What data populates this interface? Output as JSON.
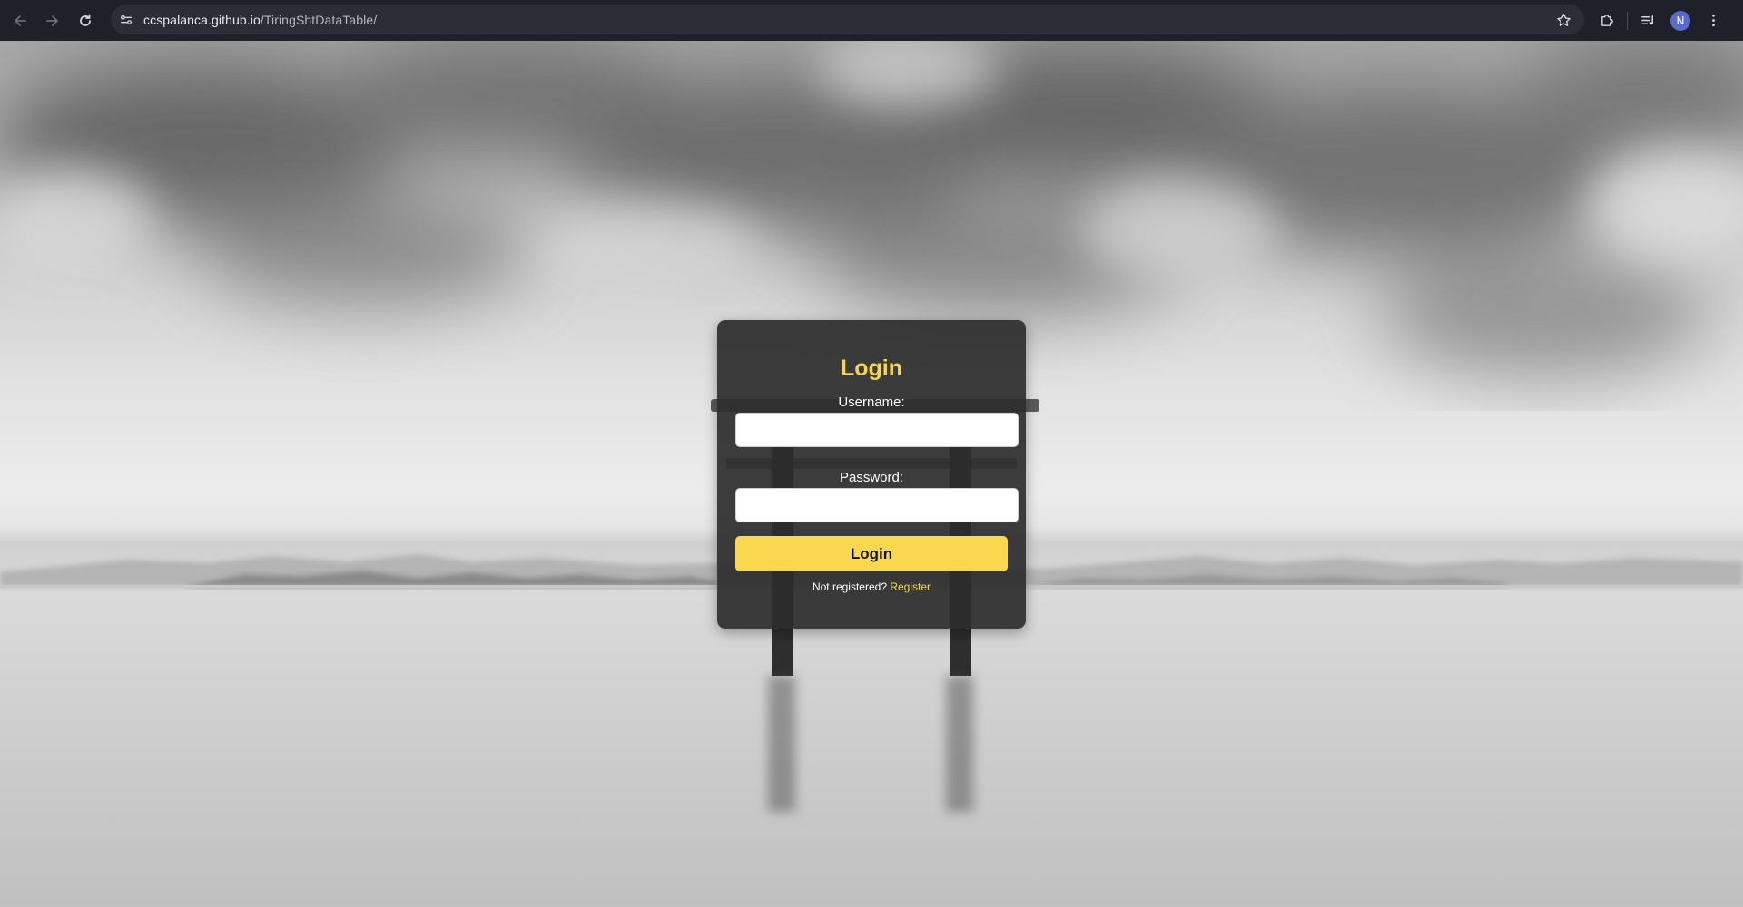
{
  "browser": {
    "url_host": "ccspalanca.github.io",
    "url_path": "/TiringShtDataTable/",
    "profile_initial": "N",
    "icons": [
      "back-arrow-icon",
      "forward-arrow-icon",
      "reload-icon",
      "site-settings-icon",
      "bookmark-star-icon",
      "extensions-puzzle-icon",
      "reading-list-icon",
      "more-menu-icon"
    ]
  },
  "login": {
    "title": "Login",
    "username_label": "Username:",
    "username_value": "",
    "password_label": "Password:",
    "password_value": "",
    "submit_label": "Login",
    "register_prompt": "Not registered?",
    "register_link": "Register"
  },
  "colors": {
    "accent": "#f7d64a",
    "button": "#f9d84f",
    "card": "#2c2c2c",
    "chrome": "#1f2128"
  }
}
